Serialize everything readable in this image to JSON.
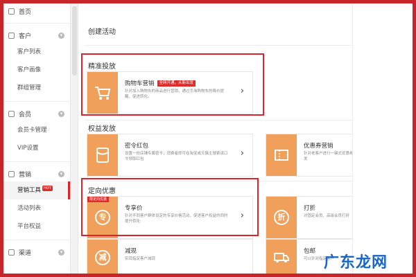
{
  "sidebar": {
    "home": "首页",
    "customers": {
      "title": "客户",
      "items": [
        "客户列表",
        "客户画像",
        "群组管理"
      ]
    },
    "members": {
      "title": "会员",
      "items": [
        "会员卡管理",
        "VIP设置"
      ]
    },
    "marketing": {
      "title": "营销",
      "items": [
        "营销工具",
        "活动列表",
        "平台权益"
      ],
      "hot_badge": "HOT"
    },
    "channel": {
      "title": "渠道"
    }
  },
  "main": {
    "page_title": "创建活动",
    "sections": [
      {
        "title": "精准投放",
        "cards": [
          {
            "title": "购物车营销",
            "tag": "全网开通，从新出发",
            "desc": "针对加入购物车的商品进行营销，通过手淘购物车的降价提醒，促进转化。",
            "icon": "cart-icon"
          }
        ]
      },
      {
        "title": "权益发放",
        "cards": [
          {
            "title": "密令红包",
            "desc": "设置一份店铺专属密令，消费者即可在淘宝或天猫主搜索该口令领取红包",
            "icon": "envelope-icon"
          },
          {
            "title": "优惠券营销",
            "desc": "针对老客户进行一键式优惠券群发",
            "icon": "coupon-icon"
          }
        ]
      },
      {
        "title": "定向优惠",
        "cards": [
          {
            "title": "专享价",
            "corner_tag": "限定向优惠",
            "desc": "针对不同客户群体设定的专享价格活动，促进客户权益的同时提升转化",
            "icon": "exclusive-icon",
            "icon_text": "专"
          },
          {
            "title": "打折",
            "desc": "对固定会员、高级会员打折",
            "icon": "discount-icon",
            "icon_text": "折"
          },
          {
            "title": "减现",
            "desc": "实现指定客户减现",
            "icon": "cash-off-icon",
            "icon_text": "减"
          },
          {
            "title": "包邮",
            "desc": "可以针对指定客户",
            "icon": "free-shipping-icon"
          }
        ]
      }
    ]
  },
  "watermark": "广东龙网",
  "colors": {
    "accent": "#d9232d",
    "orange": "#f0a05a",
    "watermark": "#1a66c7"
  }
}
